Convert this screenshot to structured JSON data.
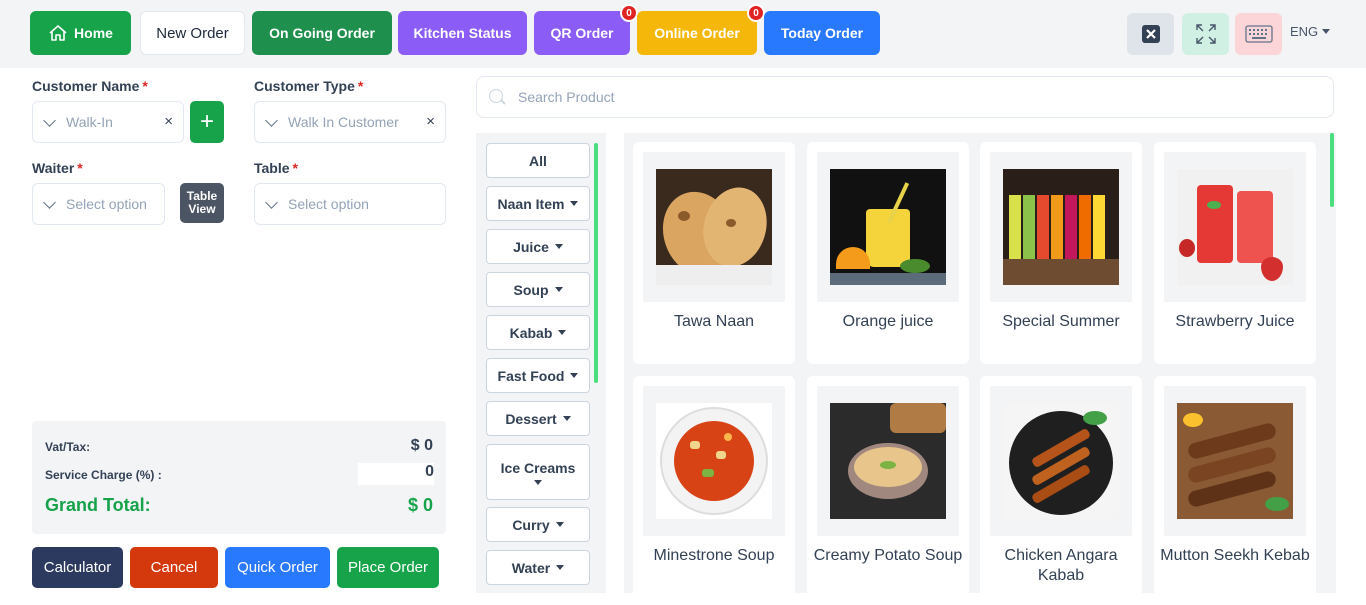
{
  "topbar": {
    "home": "Home",
    "new_order": "New Order",
    "ongoing": "On Going Order",
    "kitchen": "Kitchen Status",
    "qr": "QR Order",
    "qr_count": "0",
    "online": "Online Order",
    "online_count": "0",
    "today": "Today Order",
    "language": "ENG"
  },
  "form": {
    "customer_name_label": "Customer Name",
    "customer_name_value": "Walk-In",
    "customer_type_label": "Customer Type",
    "customer_type_value": "Walk In Customer",
    "waiter_label": "Waiter",
    "waiter_placeholder": "Select option",
    "table_label": "Table",
    "table_placeholder": "Select option",
    "table_view_line1": "Table",
    "table_view_line2": "View",
    "required_mark": "*",
    "clear_mark": "×",
    "add_mark": "+"
  },
  "totals": {
    "vat_label": "Vat/Tax:",
    "vat_value": "$ 0",
    "service_label": "Service Charge (%) :",
    "service_value": "0",
    "grand_label": "Grand Total:",
    "grand_value": "$ 0"
  },
  "actions": {
    "calculator": "Calculator",
    "cancel": "Cancel",
    "quick": "Quick Order",
    "place": "Place Order"
  },
  "search": {
    "placeholder": "Search Product"
  },
  "categories": [
    "All",
    "Naan Item",
    "Juice",
    "Soup",
    "Kabab",
    "Fast Food",
    "Dessert",
    "Ice Creams",
    "Curry",
    "Water"
  ],
  "products": [
    "Tawa Naan",
    "Orange juice",
    "Special Summer",
    "Strawberry Juice",
    "Minestrone Soup",
    "Creamy Potato Soup",
    "Chicken Angara Kabab",
    "Mutton Seekh Kebab"
  ],
  "colors": {
    "green": "#16a34a",
    "dark_green": "#1f8f4e",
    "purple": "#8b5cf6",
    "amber": "#f5b80a",
    "blue": "#2979ff",
    "navy": "#2d3a5f",
    "red": "#d4380d"
  }
}
